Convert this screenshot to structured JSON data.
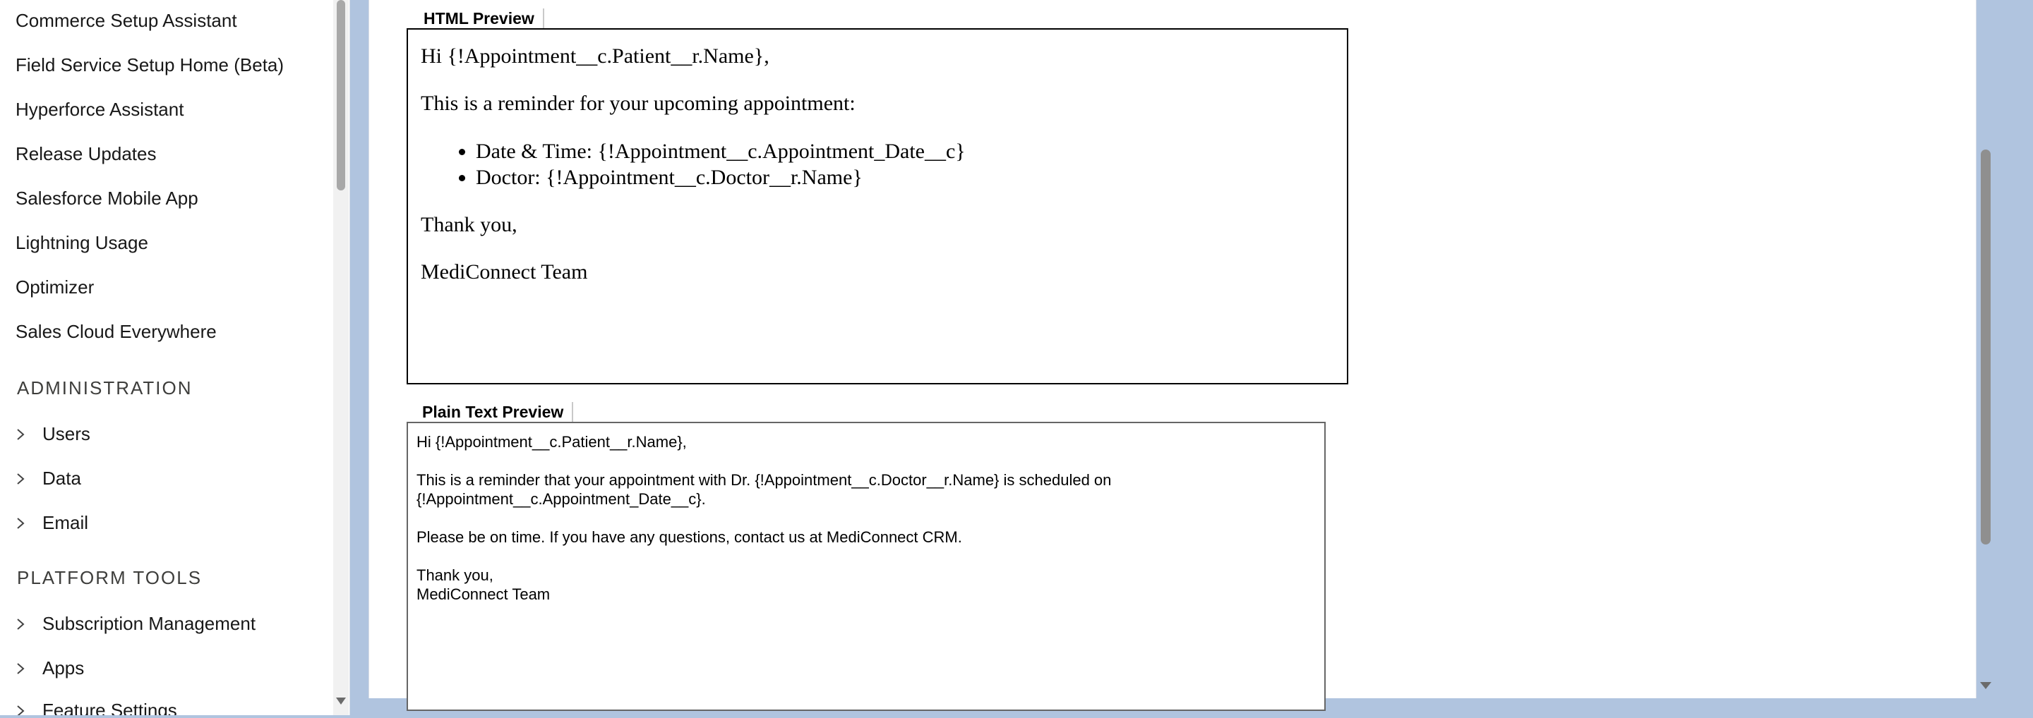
{
  "sidebar": {
    "links": [
      "Commerce Setup Assistant",
      "Field Service Setup Home (Beta)",
      "Hyperforce Assistant",
      "Release Updates",
      "Salesforce Mobile App",
      "Lightning Usage",
      "Optimizer",
      "Sales Cloud Everywhere"
    ],
    "administration": {
      "title": "ADMINISTRATION",
      "items": [
        "Users",
        "Data",
        "Email"
      ]
    },
    "platform_tools": {
      "title": "PLATFORM TOOLS",
      "items": [
        "Subscription Management",
        "Apps",
        "Feature Settings"
      ]
    }
  },
  "html_preview": {
    "label": "HTML Preview",
    "greeting": "Hi {!Appointment__c.Patient__r.Name},",
    "intro": "This is a reminder for your upcoming appointment:",
    "bullets": [
      "Date & Time: {!Appointment__c.Appointment_Date__c}",
      "Doctor: {!Appointment__c.Doctor__r.Name}"
    ],
    "closing": "Thank you,",
    "signature": "MediConnect Team"
  },
  "text_preview": {
    "label": "Plain Text Preview",
    "lines": [
      "Hi {!Appointment__c.Patient__r.Name},",
      "",
      "This is a reminder that your appointment with Dr. {!Appointment__c.Doctor__r.Name} is scheduled on",
      "{!Appointment__c.Appointment_Date__c}.",
      "",
      "Please be on time. If you have any questions, contact us at MediConnect CRM.",
      "",
      "Thank you,",
      "MediConnect Team"
    ]
  }
}
